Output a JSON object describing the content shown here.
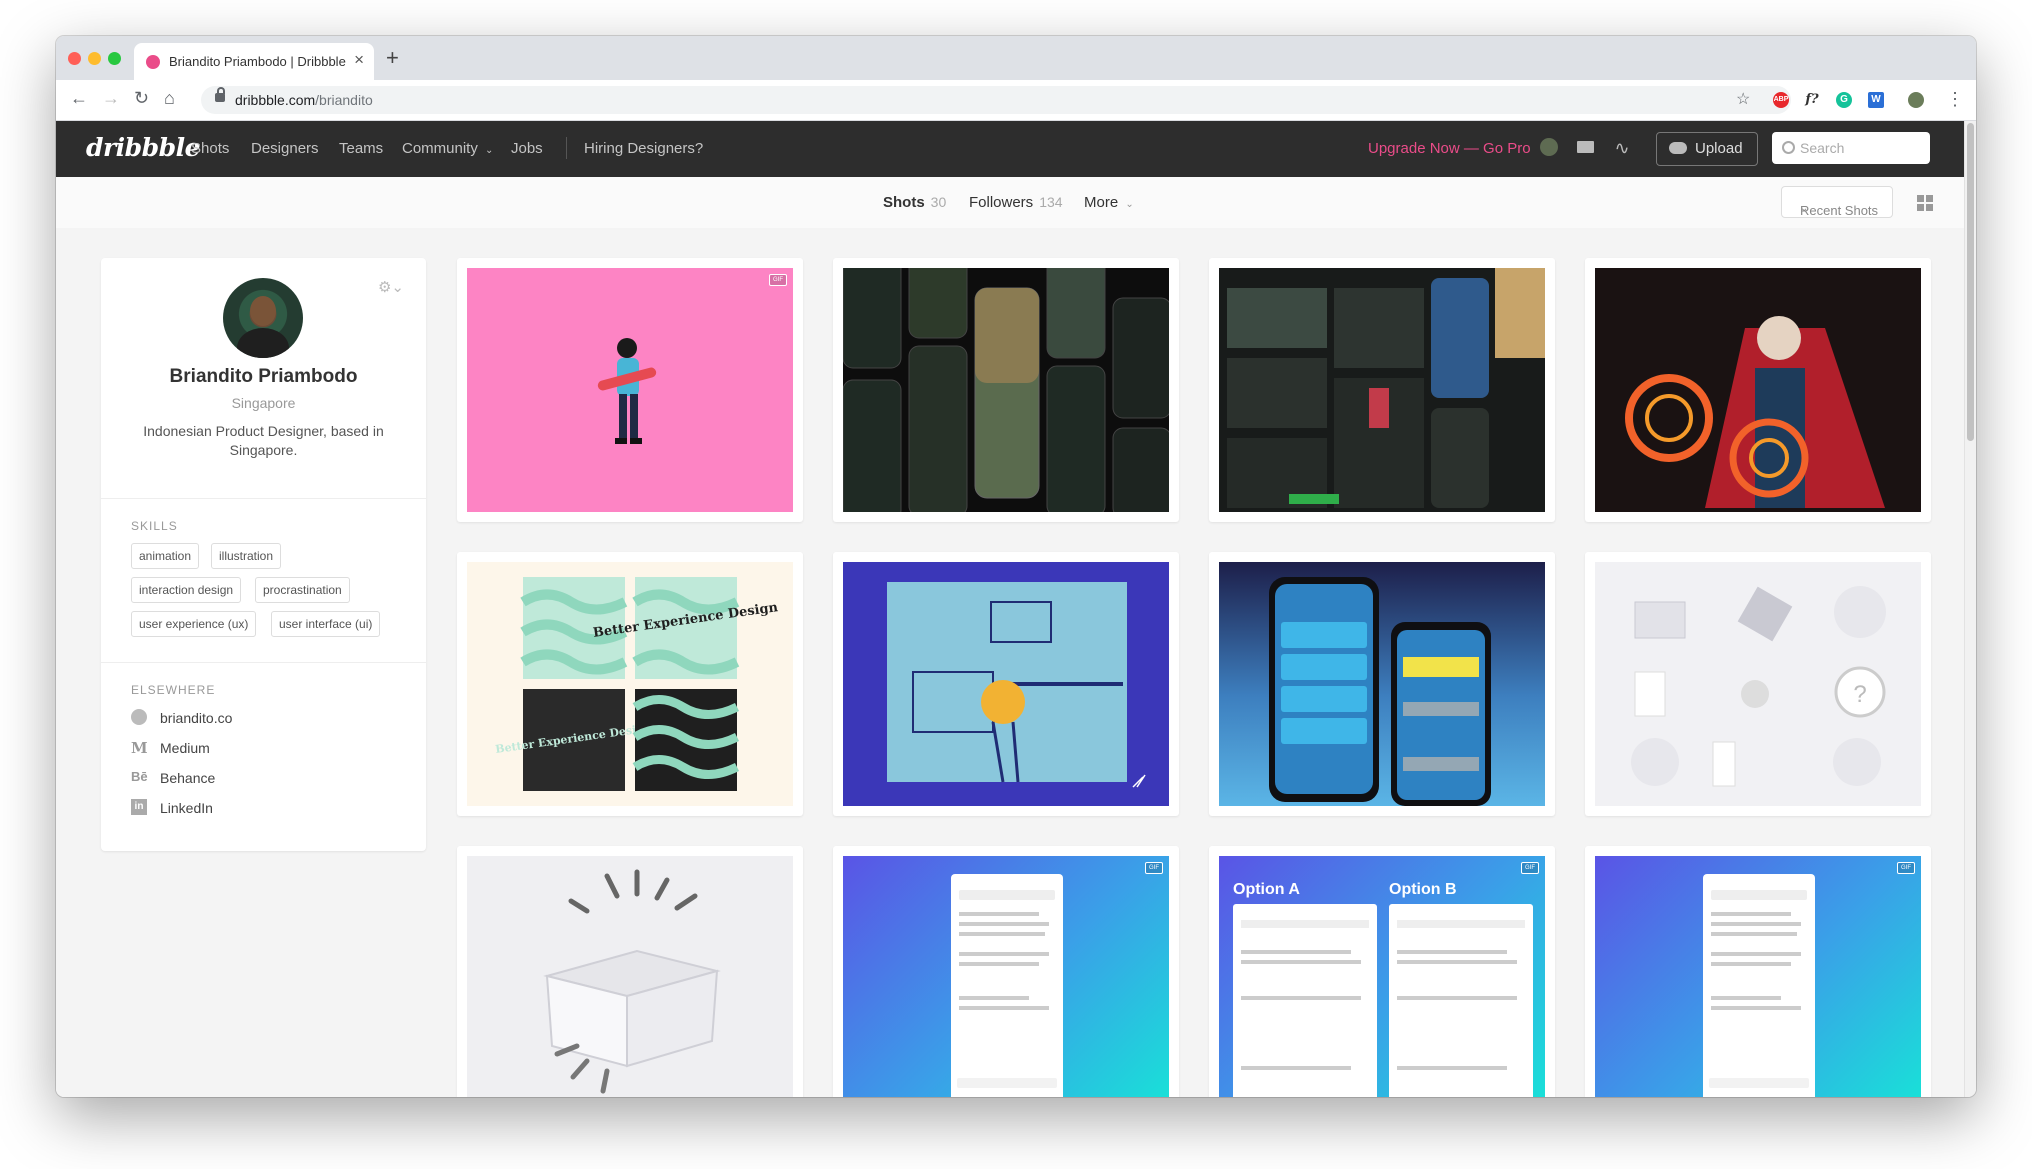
{
  "browser": {
    "tab_title": "Briandito Priambodo | Dribbble",
    "url_domain": "dribbble.com",
    "url_path": "/briandito",
    "colors": {
      "close": "#ff5f57",
      "minimize": "#febc2e",
      "maximize": "#28c840"
    },
    "extensions": [
      "abp-icon",
      "font-icon",
      "grammarly-icon",
      "w-icon",
      "profile-avatar-icon"
    ],
    "ext_labels": {
      "abp": "ABP",
      "font": "f?",
      "w": "W"
    }
  },
  "header": {
    "logo": "dribbble",
    "nav": [
      "Shots",
      "Designers",
      "Teams",
      "Community",
      "Jobs"
    ],
    "hiring": "Hiring Designers?",
    "upgrade": "Upgrade Now — Go Pro",
    "upload": "Upload",
    "search_placeholder": "Search",
    "accent": "#ea4c89"
  },
  "subnav": {
    "shots_label": "Shots",
    "shots_count": "30",
    "followers_label": "Followers",
    "followers_count": "134",
    "more_label": "More",
    "sort_label": "Recent Shots"
  },
  "profile": {
    "name": "Briandito Priambodo",
    "location": "Singapore",
    "bio": "Indonesian Product Designer, based in Singapore.",
    "skills_heading": "SKILLS",
    "skills": [
      "animation",
      "illustration",
      "interaction design",
      "procrastination",
      "user experience (ux)",
      "user interface (ui)"
    ],
    "elsewhere_heading": "ELSEWHERE",
    "links": [
      {
        "icon": "globe-icon",
        "label": "briandito.co"
      },
      {
        "icon": "medium-icon",
        "label": "Medium"
      },
      {
        "icon": "behance-icon",
        "label": "Behance"
      },
      {
        "icon": "linkedin-icon",
        "label": "LinkedIn"
      }
    ]
  },
  "shots": {
    "gif_badge": "GIF",
    "mock_texts": {
      "option_a": "Option A",
      "option_b": "Option B",
      "better_experience": "Better Experience Design"
    }
  }
}
